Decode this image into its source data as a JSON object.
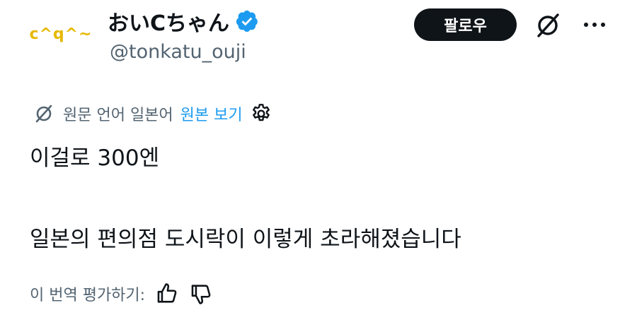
{
  "author": {
    "avatar_text": "c^q^~",
    "display_name": "おいCちゃん",
    "handle": "@tonkatu_ouji"
  },
  "actions": {
    "follow_label": "팔로우"
  },
  "translation": {
    "source_text": "원문 언어 일본어",
    "view_original": "원본 보기"
  },
  "tweet": {
    "line1": "이걸로 300엔",
    "line2": "일본의 편의점 도시락이 이렇게 초라해졌습니다"
  },
  "rating": {
    "label": "이 번역 평가하기:"
  },
  "colors": {
    "accent": "#1d9bf0",
    "text": "#0f1419",
    "muted": "#536471",
    "avatar": "#e6b800"
  }
}
